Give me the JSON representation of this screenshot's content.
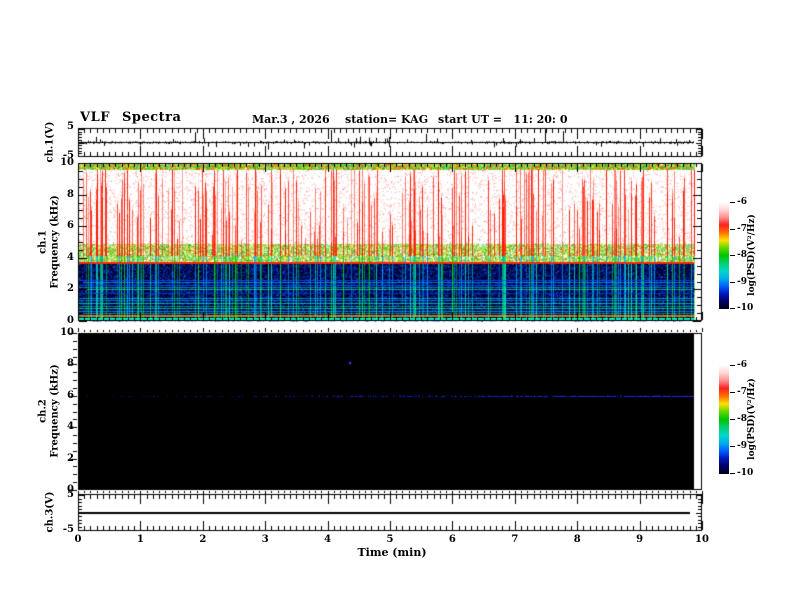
{
  "header": {
    "title": "VLF Spectra",
    "date": "Mar.3 , 2026",
    "station": "station= KAG",
    "start_ut": "start UT =   11: 20: 0"
  },
  "time_axis": {
    "label": "Time (min)",
    "ticks": [
      "0",
      "1",
      "2",
      "3",
      "4",
      "5",
      "6",
      "7",
      "8",
      "9",
      "10"
    ],
    "range": [
      0,
      10
    ],
    "minor_step_min": 0.1
  },
  "panels": {
    "ch1_wave": {
      "ylabel": "ch.1(V)",
      "ytick_labels": [
        "5",
        "-5"
      ],
      "ylim": [
        -5,
        5
      ]
    },
    "ch1_spec": {
      "ylabel_line1": "ch.1",
      "ylabel_line2": "Frequency (kHz)",
      "ytick_labels": [
        "10",
        "8",
        "6",
        "4",
        "2",
        "0"
      ],
      "ylim": [
        0,
        10
      ]
    },
    "ch2_spec": {
      "ylabel_line1": "ch.2",
      "ylabel_line2": "Frequency (kHz)",
      "ytick_labels": [
        "10",
        "8",
        "6",
        "4",
        "2",
        "0"
      ],
      "ylim": [
        0,
        10
      ]
    },
    "ch3_wave": {
      "ylabel": "ch.3(V)",
      "ytick_labels": [
        "5",
        "-5"
      ],
      "ylim": [
        -5,
        5
      ]
    }
  },
  "colorbar": {
    "label": "log(PSD)(V²/Hz)",
    "tick_labels": [
      "-6",
      "-7",
      "-8",
      "-9",
      "-10"
    ],
    "gradient_top_to_bottom": [
      "#ffffff",
      "#ffd8d8",
      "#ff9090",
      "#ff2020",
      "#ff7000",
      "#ffe000",
      "#60d800",
      "#00c400",
      "#00d070",
      "#00d8c8",
      "#00b0e8",
      "#0060ff",
      "#0018c0",
      "#000060",
      "#000018"
    ]
  },
  "chart_data": [
    {
      "panel": "ch1_wave",
      "type": "line",
      "xlim": [
        0,
        10
      ],
      "ylim": [
        -5,
        5
      ],
      "baseline_v": 0,
      "noise_amp_v": 0.5,
      "data_end_min": 9.87,
      "spikes_t_v": [
        [
          0.35,
          1.2
        ],
        [
          1.0,
          -1.0
        ],
        [
          1.52,
          1.3
        ],
        [
          1.88,
          3.8
        ],
        [
          2.02,
          1.5
        ],
        [
          2.6,
          -1.2
        ],
        [
          3.05,
          -2.6
        ],
        [
          3.3,
          1.1
        ],
        [
          3.62,
          -2.2
        ],
        [
          4.05,
          4.6
        ],
        [
          4.33,
          1.4
        ],
        [
          4.52,
          2.2
        ],
        [
          4.98,
          -1.6
        ],
        [
          5.28,
          1.2
        ],
        [
          5.57,
          3.2
        ],
        [
          5.75,
          1.5
        ],
        [
          6.3,
          1.0
        ],
        [
          6.7,
          -1.1
        ],
        [
          7.08,
          1.2
        ],
        [
          7.49,
          4.9
        ],
        [
          7.78,
          4.2
        ],
        [
          8.3,
          -1.0
        ],
        [
          8.85,
          1.1
        ],
        [
          9.32,
          1.6
        ],
        [
          9.6,
          -1.2
        ]
      ]
    },
    {
      "panel": "ch1_spec",
      "type": "heatmap",
      "xlim": [
        0,
        10
      ],
      "ylim": [
        0,
        10
      ],
      "data_end_min": 9.87,
      "bands": [
        {
          "freq_khz": [
            0,
            3.7
          ],
          "desc": "dark blue noise floor with blue speckle and cyan/green tones"
        },
        {
          "freq_khz": [
            3.7,
            4.9
          ],
          "desc": "dense green/yellow/orange speckle band"
        },
        {
          "freq_khz": [
            4.9,
            9.6
          ],
          "desc": "white background crossed by red sferic streaks"
        },
        {
          "freq_khz": [
            9.6,
            10
          ],
          "desc": "dense multicolor (green/yellow/red) band at top edge"
        }
      ],
      "streaks": {
        "count": 270,
        "top_khz_min": 4.8,
        "top_khz_max": 9.75,
        "upper_color": "#ff1800",
        "lower_colors": [
          "#00cc00",
          "#00e0b0",
          "#00a0ff"
        ]
      },
      "horizontal_lines": [
        {
          "freq_khz": 3.65,
          "color": "#ff2800",
          "alpha": 0.95,
          "thickness_px": 2
        },
        {
          "freq_khz": 2.6,
          "color": "#0050ff",
          "alpha": 0.8,
          "thickness_px": 1
        },
        {
          "freq_khz": 2.45,
          "color": "#00a0ff",
          "alpha": 0.7,
          "thickness_px": 1
        },
        {
          "freq_khz": 2.3,
          "color": "#0050ff",
          "alpha": 0.8,
          "thickness_px": 1
        },
        {
          "freq_khz": 2.18,
          "color": "#00c0c0",
          "alpha": 0.6,
          "thickness_px": 1
        },
        {
          "freq_khz": 2.05,
          "color": "#00e0c0",
          "alpha": 0.7,
          "thickness_px": 1
        },
        {
          "freq_khz": 1.75,
          "color": "#0040ff",
          "alpha": 0.6,
          "thickness_px": 1
        },
        {
          "freq_khz": 1.45,
          "color": "#00d0e0",
          "alpha": 0.6,
          "thickness_px": 1
        },
        {
          "freq_khz": 1.3,
          "color": "#00a0ff",
          "alpha": 0.6,
          "thickness_px": 1
        },
        {
          "freq_khz": 1.12,
          "color": "#00e0c0",
          "alpha": 0.7,
          "thickness_px": 1
        },
        {
          "freq_khz": 0.95,
          "color": "#00d060",
          "alpha": 0.6,
          "thickness_px": 1
        },
        {
          "freq_khz": 0.8,
          "color": "#00e0c0",
          "alpha": 0.7,
          "thickness_px": 1
        },
        {
          "freq_khz": 0.62,
          "color": "#00c0ff",
          "alpha": 0.6,
          "thickness_px": 1
        },
        {
          "freq_khz": 0.5,
          "color": "#00e080",
          "alpha": 0.5,
          "thickness_px": 1
        },
        {
          "freq_khz": 0.38,
          "color": "#ff9000",
          "alpha": 0.8,
          "thickness_px": 1
        },
        {
          "freq_khz": 0.3,
          "color": "#ffd000",
          "alpha": 0.6,
          "thickness_px": 1
        },
        {
          "freq_khz": 0.22,
          "color": "#00e060",
          "alpha": 0.8,
          "thickness_px": 1
        },
        {
          "freq_khz": 0.12,
          "color": "#00ffc0",
          "alpha": 0.9,
          "thickness_px": 2
        },
        {
          "freq_khz": 0.05,
          "color": "#00c000",
          "alpha": 0.9,
          "thickness_px": 1
        }
      ]
    },
    {
      "panel": "ch2_spec",
      "type": "heatmap",
      "xlim": [
        0,
        10
      ],
      "ylim": [
        0,
        10
      ],
      "data_end_min": 9.87,
      "background": "#000000",
      "horizontal_lines": [
        {
          "freq_khz": 6.0,
          "color": "#2222e6",
          "desc": "faint intermittent carrier line, denser and brighter toward the right"
        }
      ],
      "points": [
        {
          "t_min": 4.35,
          "freq_khz": 8.15,
          "color": "#4040ff"
        }
      ]
    },
    {
      "panel": "ch3_wave",
      "type": "line",
      "xlim": [
        0,
        10
      ],
      "ylim": [
        -5,
        5
      ],
      "flat_value_v": 0,
      "data_end_min": 9.8
    }
  ]
}
